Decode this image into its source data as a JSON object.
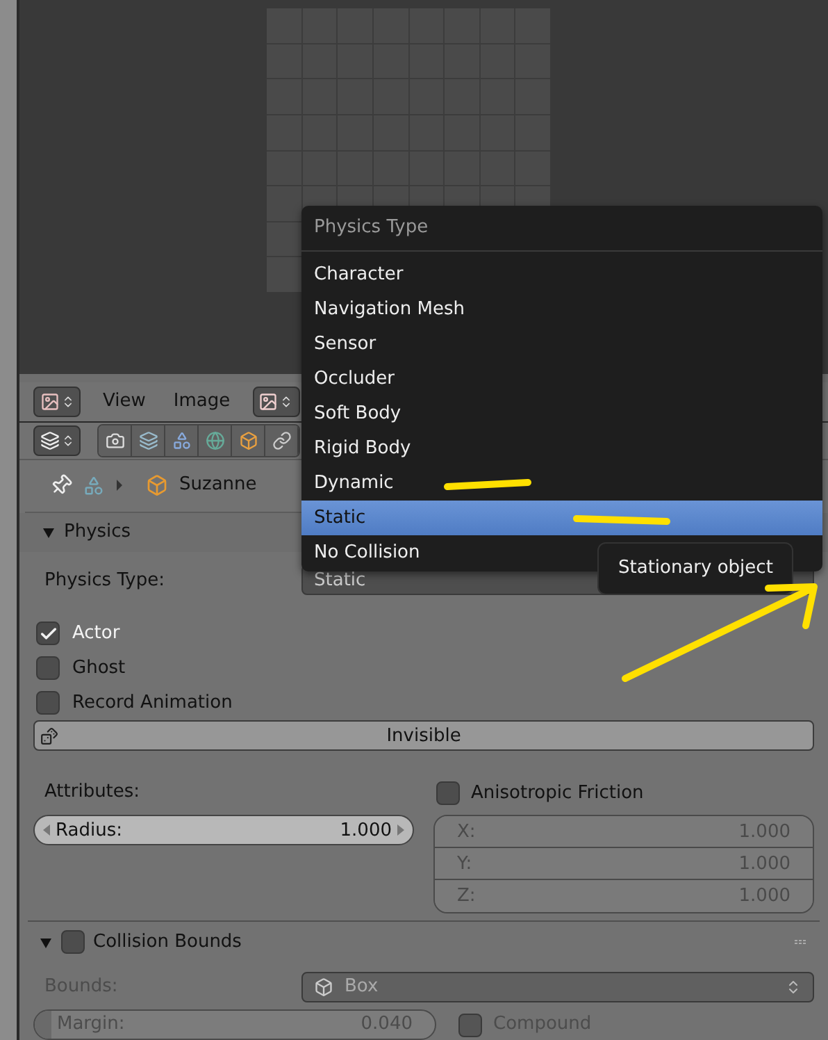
{
  "image_editor": {
    "header": {
      "menus": [
        "View",
        "Image"
      ]
    }
  },
  "properties": {
    "breadcrumb": {
      "object": "Suzanne"
    },
    "physics": {
      "title": "Physics",
      "expanded": true,
      "physics_type": {
        "label": "Physics Type:",
        "value": "Static"
      },
      "options": [
        {
          "label": "Actor",
          "checked": true
        },
        {
          "label": "Ghost",
          "checked": false
        },
        {
          "label": "Record Animation",
          "checked": false
        }
      ],
      "invisible_button": "Invisible",
      "attributes_label": "Attributes:",
      "radius": {
        "label": "Radius:",
        "value": "1.000"
      },
      "anisotropic_friction": {
        "label": "Anisotropic Friction",
        "checked": false,
        "axes": [
          {
            "label": "X:",
            "value": "1.000"
          },
          {
            "label": "Y:",
            "value": "1.000"
          },
          {
            "label": "Z:",
            "value": "1.000"
          }
        ]
      }
    },
    "collision_bounds": {
      "title": "Collision Bounds",
      "expanded": true,
      "checked": false,
      "bounds": {
        "label": "Bounds:",
        "value": "Box"
      },
      "margin": {
        "label": "Margin:",
        "value": "0.040",
        "level": 0.04
      },
      "compound": {
        "label": "Compound",
        "checked": false
      }
    }
  },
  "dropdown_menu": {
    "title": "Physics Type",
    "items": [
      {
        "label": "Character",
        "selected": false
      },
      {
        "label": "Navigation Mesh",
        "selected": false
      },
      {
        "label": "Sensor",
        "selected": false
      },
      {
        "label": "Occluder",
        "selected": false
      },
      {
        "label": "Soft Body",
        "selected": false
      },
      {
        "label": "Rigid Body",
        "selected": false
      },
      {
        "label": "Dynamic",
        "selected": false
      },
      {
        "label": "Static",
        "selected": true
      },
      {
        "label": "No Collision",
        "selected": false
      }
    ]
  },
  "tooltip": "Stationary object"
}
